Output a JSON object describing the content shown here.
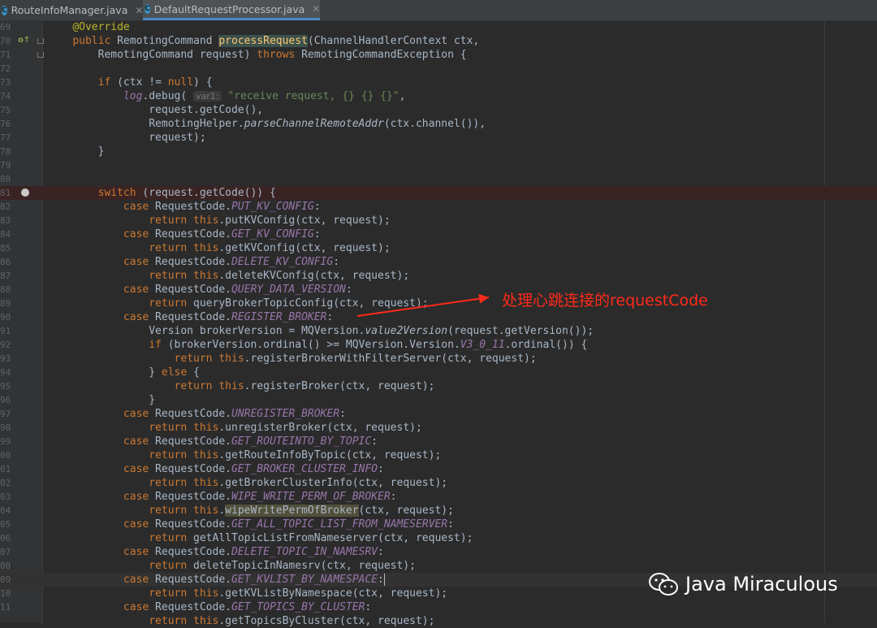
{
  "tabs": [
    {
      "label": "RouteInfoManager.java",
      "icon": "class-icon",
      "icon_letter": "C",
      "active": false
    },
    {
      "label": "DefaultRequestProcessor.java",
      "icon": "class-icon",
      "icon_letter": "C",
      "active": true
    }
  ],
  "annotation": {
    "text": "处理心跳连接的requestCode",
    "color": "#ff2a1a"
  },
  "watermark": {
    "text": "Java Miraculous",
    "icon": "wechat-icon"
  },
  "colors": {
    "background": "#2b2b2b",
    "keyword": "#cc7832",
    "constant": "#9876aa",
    "string": "#6a8759",
    "method": "#ffc66d"
  },
  "code": {
    "line_numbers": [
      "69",
      "70",
      "71",
      "72",
      "73",
      "74",
      "75",
      "76",
      "77",
      "78",
      "79",
      "80",
      "81",
      "82",
      "83",
      "84",
      "85",
      "86",
      "87",
      "88",
      "89",
      "90",
      "91",
      "92",
      "93",
      "94",
      "95",
      "96",
      "97",
      "98",
      "99",
      "00",
      "01",
      "02",
      "03",
      "04",
      "05",
      "06",
      "07",
      "08",
      "09",
      "10",
      "11"
    ],
    "param_hint": "var1:",
    "lines": [
      "    @Override",
      "    public RemotingCommand processRequest(ChannelHandlerContext ctx,",
      "        RemotingCommand request) throws RemotingCommandException {",
      "",
      "        if (ctx != null) {",
      "            log.debug( \"receive request, {} {} {}\",",
      "                request.getCode(),",
      "                RemotingHelper.parseChannelRemoteAddr(ctx.channel()),",
      "                request);",
      "        }",
      "",
      "",
      "        switch (request.getCode()) {",
      "            case RequestCode.PUT_KV_CONFIG:",
      "                return this.putKVConfig(ctx, request);",
      "            case RequestCode.GET_KV_CONFIG:",
      "                return this.getKVConfig(ctx, request);",
      "            case RequestCode.DELETE_KV_CONFIG:",
      "                return this.deleteKVConfig(ctx, request);",
      "            case RequestCode.QUERY_DATA_VERSION:",
      "                return queryBrokerTopicConfig(ctx, request);",
      "            case RequestCode.REGISTER_BROKER:",
      "                Version brokerVersion = MQVersion.value2Version(request.getVersion());",
      "                if (brokerVersion.ordinal() >= MQVersion.Version.V3_0_11.ordinal()) {",
      "                    return this.registerBrokerWithFilterServer(ctx, request);",
      "                } else {",
      "                    return this.registerBroker(ctx, request);",
      "                }",
      "            case RequestCode.UNREGISTER_BROKER:",
      "                return this.unregisterBroker(ctx, request);",
      "            case RequestCode.GET_ROUTEINTO_BY_TOPIC:",
      "                return this.getRouteInfoByTopic(ctx, request);",
      "            case RequestCode.GET_BROKER_CLUSTER_INFO:",
      "                return this.getBrokerClusterInfo(ctx, request);",
      "            case RequestCode.WIPE_WRITE_PERM_OF_BROKER:",
      "                return this.wipeWritePermOfBroker(ctx, request);",
      "            case RequestCode.GET_ALL_TOPIC_LIST_FROM_NAMESERVER:",
      "                return getAllTopicListFromNameserver(ctx, request);",
      "            case RequestCode.DELETE_TOPIC_IN_NAMESRV:",
      "                return deleteTopicInNamesrv(ctx, request);",
      "            case RequestCode.GET_KVLIST_BY_NAMESPACE:",
      "                return this.getKVListByNamespace(ctx, request);",
      "            case RequestCode.GET_TOPICS_BY_CLUSTER:",
      "                return this.getTopicsByCluster(ctx, request);"
    ]
  }
}
